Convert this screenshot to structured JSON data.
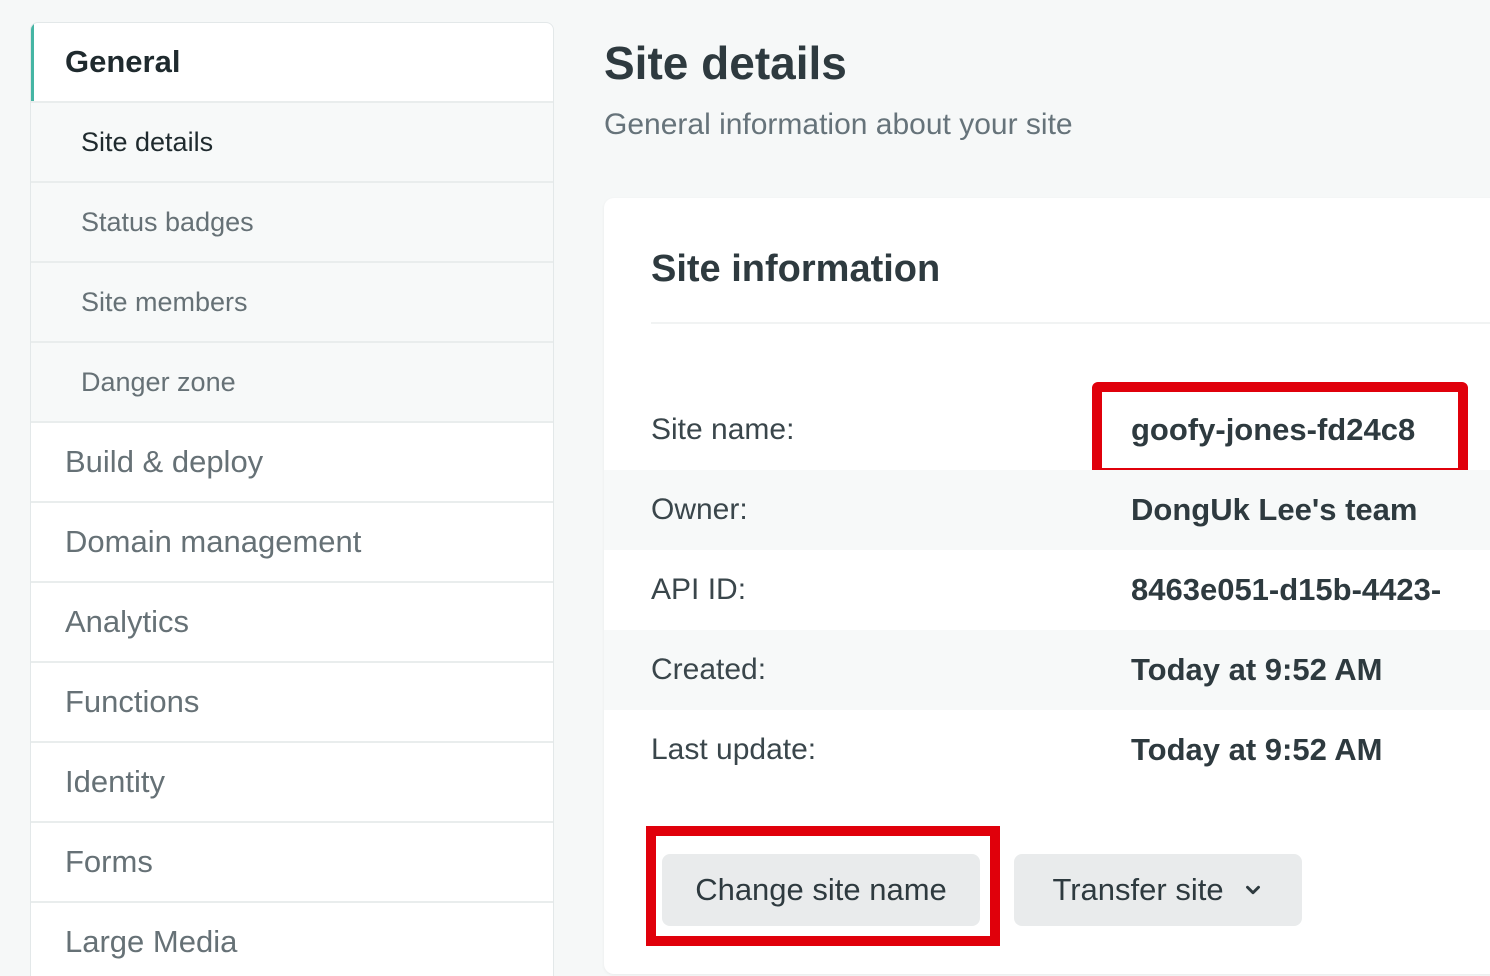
{
  "sidebar": {
    "items": [
      {
        "label": "General",
        "active": true
      },
      {
        "label": "Site details",
        "sub": true
      },
      {
        "label": "Status badges",
        "sub": true
      },
      {
        "label": "Site members",
        "sub": true
      },
      {
        "label": "Danger zone",
        "sub": true
      },
      {
        "label": "Build & deploy"
      },
      {
        "label": "Domain management"
      },
      {
        "label": "Analytics"
      },
      {
        "label": "Functions"
      },
      {
        "label": "Identity"
      },
      {
        "label": "Forms"
      },
      {
        "label": "Large Media"
      }
    ]
  },
  "main": {
    "title": "Site details",
    "subtitle": "General information about your site"
  },
  "card": {
    "title": "Site information",
    "rows": [
      {
        "label": "Site name:",
        "value": "goofy-jones-fd24c8"
      },
      {
        "label": "Owner:",
        "value": "DongUk Lee's team"
      },
      {
        "label": "API ID:",
        "value": "8463e051-d15b-4423-"
      },
      {
        "label": "Created:",
        "value": "Today at 9:52 AM"
      },
      {
        "label": "Last update:",
        "value": "Today at 9:52 AM"
      }
    ],
    "buttons": {
      "change_label": "Change site name",
      "transfer_label": "Transfer site"
    }
  },
  "colors": {
    "accent": "#45b5a4",
    "highlight": "#e0000b",
    "background": "#f6f8f8"
  },
  "icons": {
    "transfer_dropdown": "chevron-down-icon"
  }
}
